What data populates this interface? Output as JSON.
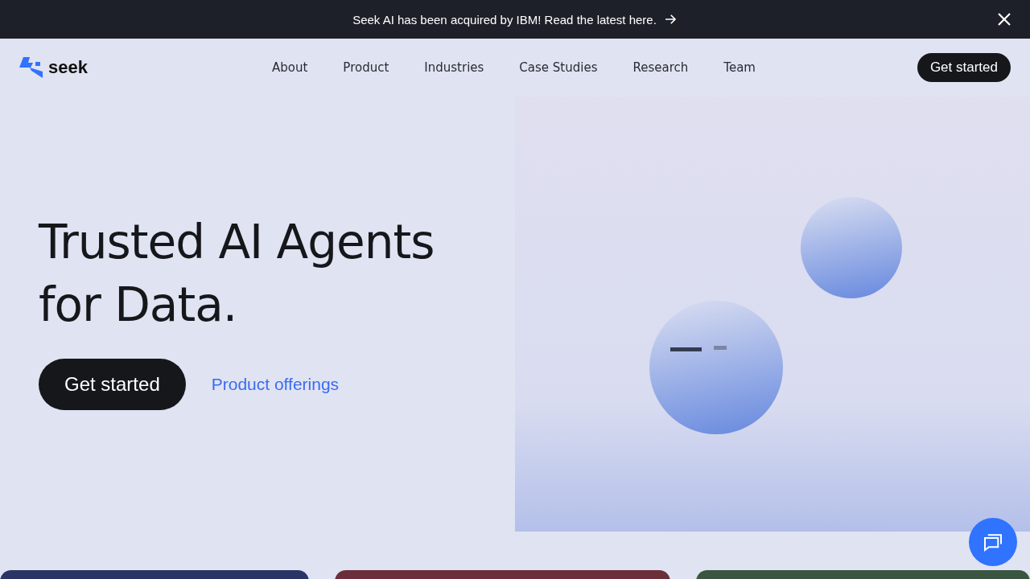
{
  "announcement": {
    "text": "Seek AI has been acquired by IBM! Read the latest here."
  },
  "header": {
    "logo": "seek",
    "nav": [
      "About",
      "Product",
      "Industries",
      "Case Studies",
      "Research",
      "Team"
    ],
    "cta": "Get started"
  },
  "hero": {
    "title_lines": [
      "Trusted AI Agents",
      "for Data."
    ],
    "primary_button": "Get started",
    "secondary_link": "Product offerings",
    "media": {
      "kind": "picture"
    }
  },
  "cards": [
    {
      "color": "#2a3566"
    },
    {
      "color": "#6b2e3b"
    },
    {
      "color": "#3a5640"
    }
  ]
}
